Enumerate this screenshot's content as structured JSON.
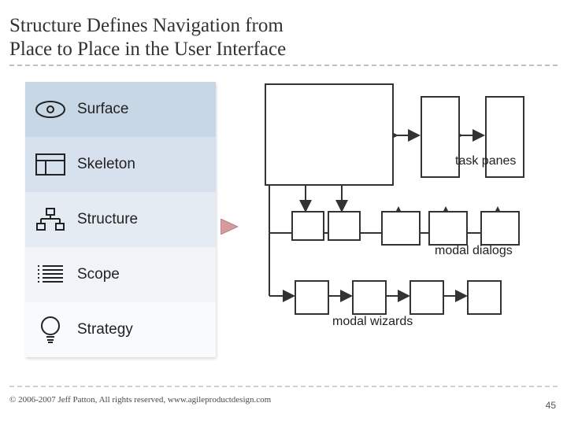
{
  "title_line1": "Structure Defines Navigation from",
  "title_line2": "Place to Place in the User Interface",
  "layers": {
    "items": [
      {
        "label": "Surface"
      },
      {
        "label": "Skeleton"
      },
      {
        "label": "Structure"
      },
      {
        "label": "Scope"
      },
      {
        "label": "Strategy"
      }
    ]
  },
  "diagram": {
    "label_task_panes": "task panes",
    "label_modal_dialogs": "modal dialogs",
    "label_modal_wizards": "modal wizards"
  },
  "footer": {
    "copyright": "© 2006-2007 Jeff Patton, All rights reserved, www.agileproductdesign.com",
    "page": "45"
  }
}
